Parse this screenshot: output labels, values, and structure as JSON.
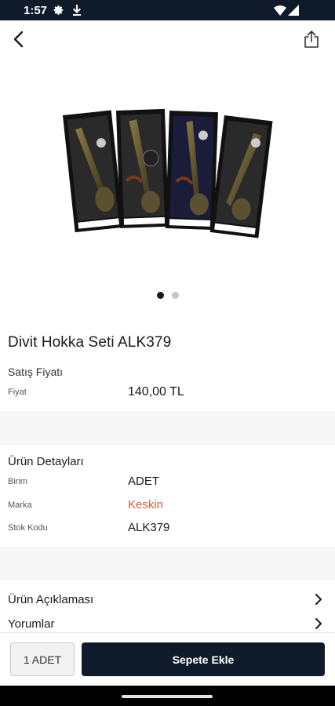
{
  "status_bar": {
    "time": "1:57",
    "icons": [
      "settings-gear-icon",
      "download-icon",
      "wifi-icon",
      "signal-icon",
      "battery-icon"
    ]
  },
  "top_bar": {
    "back_icon": "chevron-left-icon",
    "share_icon": "share-icon"
  },
  "gallery": {
    "image_subject": "quill-pen-and-ink-set-boxes",
    "slides": 2,
    "active_slide": 1
  },
  "product": {
    "title": "Divit Hokka Seti ALK379",
    "price_section": "Satış Fiyatı",
    "price_label": "Fiyat",
    "price_value": "140,00 TL"
  },
  "details": {
    "heading": "Ürün Detayları",
    "rows": [
      {
        "label": "Birim",
        "value": "ADET"
      },
      {
        "label": "Marka",
        "value": "Keskin"
      },
      {
        "label": "Stok Kodu",
        "value": "ALK379"
      }
    ]
  },
  "menu": {
    "description": "Ürün Açıklaması",
    "reviews": "Yorumlar"
  },
  "actions": {
    "quantity": "1 ADET",
    "add_to_cart": "Sepete Ekle"
  },
  "colors": {
    "primary": "#0f1b2b",
    "brand_accent": "#e8552f",
    "section_gap": "#f7f7f7"
  }
}
